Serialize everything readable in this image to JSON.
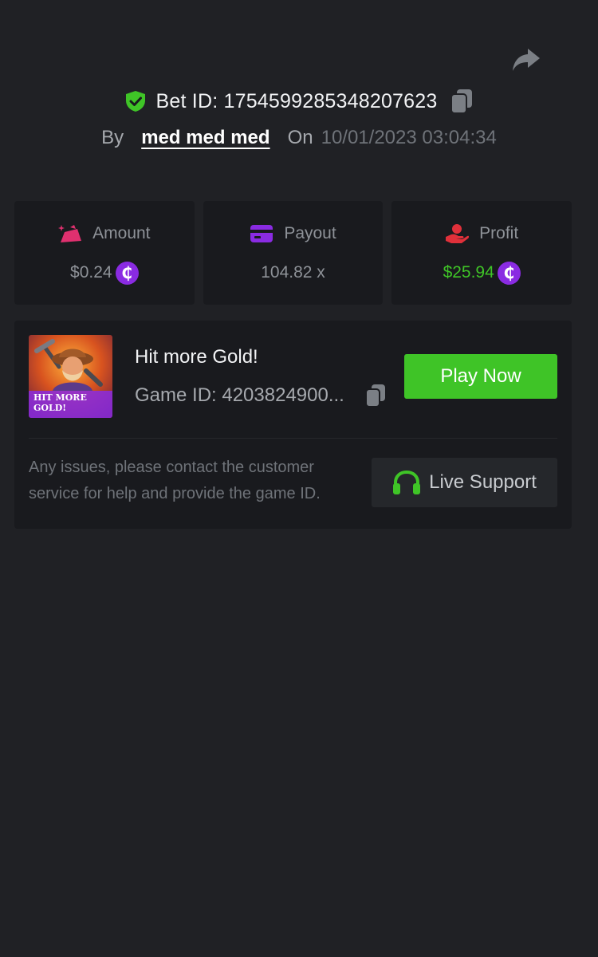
{
  "header": {
    "bet_id_label": "Bet ID: 1754599285348207623",
    "by_label": "By",
    "username": "med med med",
    "on_label": "On",
    "datetime": "10/01/2023 03:04:34",
    "icons": {
      "verified": "shield-check-icon",
      "share": "share-icon",
      "copy": "copy-icon"
    }
  },
  "stats": [
    {
      "label": "Amount",
      "value": "$0.24",
      "icon": "money-bag-icon",
      "coin": "₵",
      "icon_color": "#e0306f"
    },
    {
      "label": "Payout",
      "value": "104.82 x",
      "icon": "card-icon",
      "icon_color": "#8a2be2"
    },
    {
      "label": "Profit",
      "value": "$25.94",
      "icon": "hand-coin-icon",
      "coin": "₵",
      "icon_color": "#e0303a"
    }
  ],
  "game": {
    "title": "Hit more Gold!",
    "game_id_label": "Game ID: 4203824900...",
    "thumbnail_text": "HIT MORE GOLD!",
    "play_label": "Play Now",
    "help_text": "Any issues, please contact the customer service for help and provide the game ID.",
    "support_label": "Live Support"
  },
  "colors": {
    "background": "#202125",
    "card": "#191a1e",
    "accent_green": "#3fc427",
    "coin_purple": "#8a2be2",
    "muted_text": "#6f7379"
  }
}
